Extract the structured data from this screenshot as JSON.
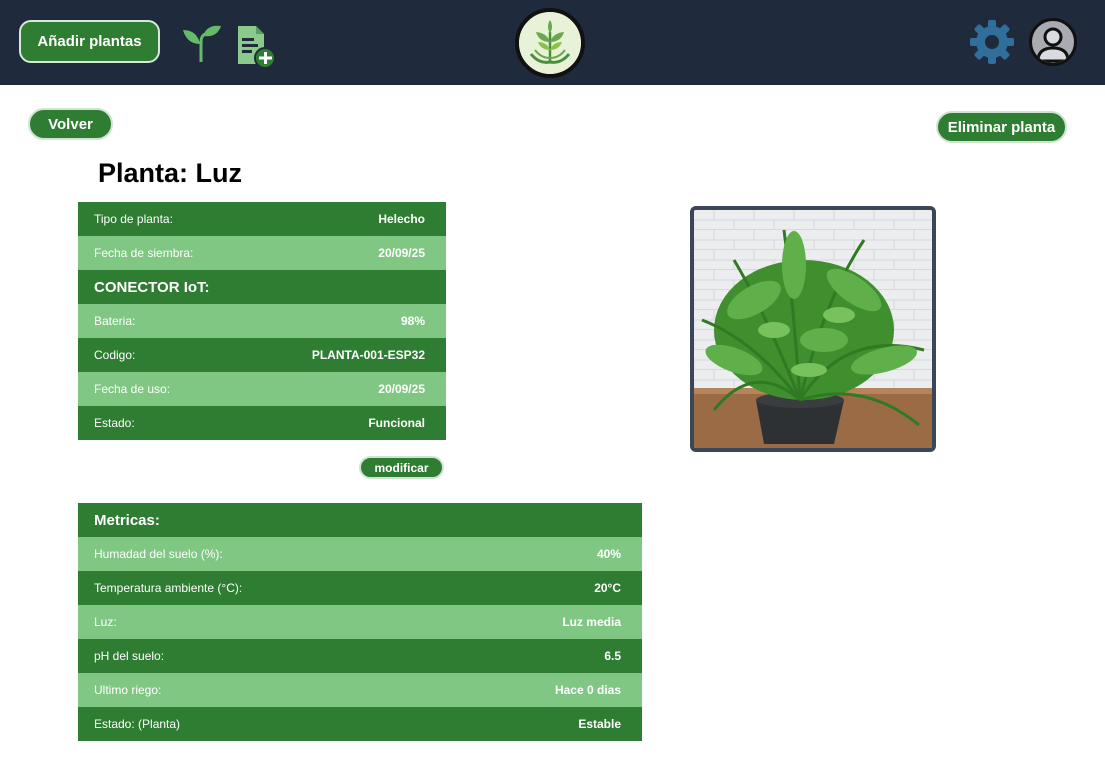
{
  "header": {
    "add_button_label": "Añadir plantas",
    "icons": [
      "sprout-icon",
      "add-document-icon",
      "app-logo",
      "gear-icon",
      "user-avatar-icon"
    ],
    "brand_color": "#1f2a3c"
  },
  "actions": {
    "back_label": "Volver",
    "delete_label": "Eliminar planta",
    "modify_label": "modificar"
  },
  "plant": {
    "title": "Planta: Luz",
    "rows": [
      {
        "label": "Tipo de planta:",
        "value": "Helecho"
      },
      {
        "label": "Fecha de siembra:",
        "value": "20/09/25"
      }
    ],
    "iot_header": "CONECTOR IoT:",
    "iot_rows": [
      {
        "label": "Bateria:",
        "value": "98%"
      },
      {
        "label": "Codigo:",
        "value": "PLANTA-001-ESP32"
      },
      {
        "label": "Fecha de uso:",
        "value": "20/09/25"
      },
      {
        "label": "Estado:",
        "value": "Funcional"
      }
    ]
  },
  "metrics": {
    "header": "Metricas:",
    "rows": [
      {
        "label": "Humadad del suelo (%):",
        "value": "40%"
      },
      {
        "label": "Temperatura ambiente (°C):",
        "value": "20°C"
      },
      {
        "label": "Luz:",
        "value": "Luz media"
      },
      {
        "label": "pH del suelo:",
        "value": "6.5"
      },
      {
        "label": "Ultimo riego:",
        "value": "Hace 0 dias"
      },
      {
        "label": "Estado: (Planta)",
        "value": "Estable"
      }
    ]
  },
  "colors": {
    "green_dark": "#2e7d32",
    "green_light": "#81c784"
  }
}
